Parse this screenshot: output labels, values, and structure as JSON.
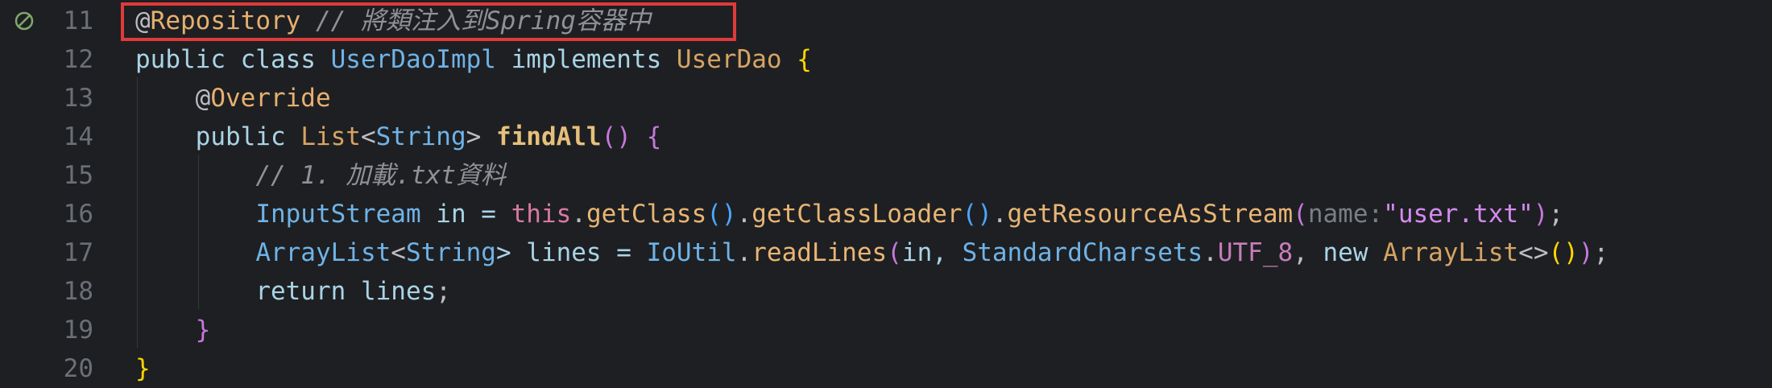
{
  "editor": {
    "lines": [
      {
        "number": "11",
        "tokens": [
          {
            "t": "@",
            "c": "at"
          },
          {
            "t": "Repository",
            "c": "annot"
          },
          {
            "t": " ",
            "c": "plain"
          },
          {
            "t": "// 將類注入到Spring容器中",
            "c": "comment"
          }
        ]
      },
      {
        "number": "12",
        "tokens": [
          {
            "t": "public class ",
            "c": "kw-blue"
          },
          {
            "t": "UserDaoImpl",
            "c": "type"
          },
          {
            "t": " implements ",
            "c": "kw-blue"
          },
          {
            "t": "UserDao",
            "c": "type2"
          },
          {
            "t": " ",
            "c": "plain"
          },
          {
            "t": "{",
            "c": "brace-y"
          }
        ]
      },
      {
        "number": "13",
        "tokens": [
          {
            "t": "    ",
            "c": "plain"
          },
          {
            "t": "@",
            "c": "at"
          },
          {
            "t": "Override",
            "c": "annot"
          }
        ]
      },
      {
        "number": "14",
        "tokens": [
          {
            "t": "    ",
            "c": "plain"
          },
          {
            "t": "public ",
            "c": "kw-blue"
          },
          {
            "t": "List",
            "c": "type2"
          },
          {
            "t": "<",
            "c": "plain"
          },
          {
            "t": "String",
            "c": "type"
          },
          {
            "t": "> ",
            "c": "plain"
          },
          {
            "t": "findAll",
            "c": "method"
          },
          {
            "t": "()",
            "c": "paren-p"
          },
          {
            "t": " ",
            "c": "plain"
          },
          {
            "t": "{",
            "c": "brace-p"
          }
        ]
      },
      {
        "number": "15",
        "tokens": [
          {
            "t": "        ",
            "c": "plain"
          },
          {
            "t": "// 1. 加載.txt資料",
            "c": "comment"
          }
        ]
      },
      {
        "number": "16",
        "tokens": [
          {
            "t": "        ",
            "c": "plain"
          },
          {
            "t": "InputStream",
            "c": "type"
          },
          {
            "t": " in = ",
            "c": "var"
          },
          {
            "t": "this",
            "c": "this"
          },
          {
            "t": ".",
            "c": "plain"
          },
          {
            "t": "getClass",
            "c": "call"
          },
          {
            "t": "()",
            "c": "paren-b"
          },
          {
            "t": ".",
            "c": "plain"
          },
          {
            "t": "getClassLoader",
            "c": "call"
          },
          {
            "t": "()",
            "c": "paren-b"
          },
          {
            "t": ".",
            "c": "plain"
          },
          {
            "t": "getResourceAsStream",
            "c": "call"
          },
          {
            "t": "(",
            "c": "paren-p"
          },
          {
            "t": "name:",
            "c": "param-hint"
          },
          {
            "t": "\"user.txt\"",
            "c": "str"
          },
          {
            "t": ")",
            "c": "paren-p"
          },
          {
            "t": ";",
            "c": "plain"
          }
        ]
      },
      {
        "number": "17",
        "tokens": [
          {
            "t": "        ",
            "c": "plain"
          },
          {
            "t": "ArrayList",
            "c": "type"
          },
          {
            "t": "<",
            "c": "plain"
          },
          {
            "t": "String",
            "c": "type"
          },
          {
            "t": "> lines = ",
            "c": "var"
          },
          {
            "t": "IoUtil",
            "c": "type"
          },
          {
            "t": ".",
            "c": "plain"
          },
          {
            "t": "readLines",
            "c": "call"
          },
          {
            "t": "(",
            "c": "paren-p"
          },
          {
            "t": "in, ",
            "c": "var"
          },
          {
            "t": "StandardCharsets",
            "c": "type"
          },
          {
            "t": ".",
            "c": "plain"
          },
          {
            "t": "UTF_8",
            "c": "field"
          },
          {
            "t": ", ",
            "c": "plain"
          },
          {
            "t": "new ",
            "c": "kw-blue"
          },
          {
            "t": "ArrayList",
            "c": "type2"
          },
          {
            "t": "<>",
            "c": "plain"
          },
          {
            "t": "()",
            "c": "brace-y"
          },
          {
            "t": ")",
            "c": "paren-p"
          },
          {
            "t": ";",
            "c": "plain"
          }
        ]
      },
      {
        "number": "18",
        "tokens": [
          {
            "t": "        ",
            "c": "plain"
          },
          {
            "t": "return ",
            "c": "kw-blue"
          },
          {
            "t": "lines",
            "c": "var"
          },
          {
            "t": ";",
            "c": "plain"
          }
        ]
      },
      {
        "number": "19",
        "tokens": [
          {
            "t": "    ",
            "c": "plain"
          },
          {
            "t": "}",
            "c": "brace-p"
          }
        ]
      },
      {
        "number": "20",
        "tokens": [
          {
            "t": "}",
            "c": "brace-y"
          }
        ]
      }
    ],
    "gutter_icon": "no-implementation-icon",
    "highlight_color": "#e03a3a"
  }
}
